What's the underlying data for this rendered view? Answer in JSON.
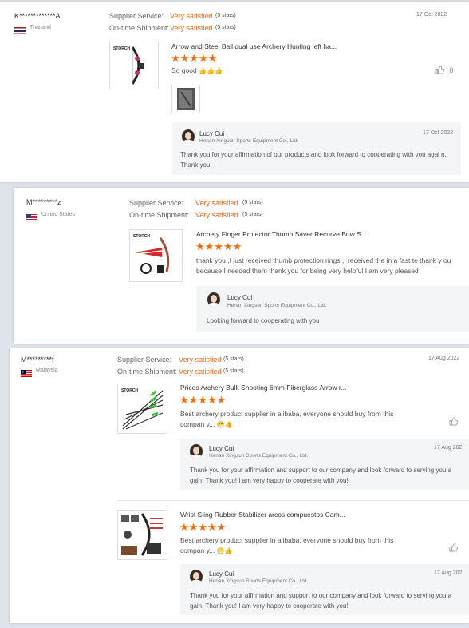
{
  "labels": {
    "supplier_service": "Supplier Service:",
    "ontime_shipment": "On-time Shipment:"
  },
  "reviews": [
    {
      "buyer": "K*************A",
      "country": "Thailand",
      "supplier_rating": "Very satisfied",
      "supplier_stars": "(5 stars)",
      "shipment_rating": "Very satisfied",
      "shipment_stars": "(5 stars)",
      "date": "17 Oct 2022",
      "products": [
        {
          "title": "Arrow and Steel Ball dual use Archery Hunting left ha...",
          "stars": "★★★★★",
          "comment": "So good",
          "emoji": "👍👍👍",
          "like_count": "0",
          "reply": {
            "name": "Lucy Cui",
            "company": "Henan Xingsun Sports Equipment Co., Ltd.",
            "date": "17 Oct 2022",
            "text": "Thank you for your affirmation of our products and look forward to cooperating with you agai n. Thank you!"
          }
        }
      ]
    },
    {
      "buyer": "M*********z",
      "country": "United States",
      "supplier_rating": "Very satisfied",
      "supplier_stars": "(5 stars)",
      "shipment_rating": "Very satisfied",
      "shipment_stars": "(5 stars)",
      "products": [
        {
          "title": "Archery Finger Protector Thumb Saver Recurve Bow S...",
          "stars": "★★★★★",
          "comment": "thank you ,I just received thumb protection rings ,I received the in a fast te thank y ou because I needed them thank you for being very helpful I am very pleased",
          "reply": {
            "name": "Lucy Cui",
            "company": "Henan Xingsun Sports Equipment Co., Ltd.",
            "text": "Looking forward to cooperating with you"
          }
        }
      ]
    },
    {
      "buyer": "M*********f",
      "country": "Malaysia",
      "supplier_rating": "Very satisfied",
      "supplier_stars": "(5 stars)",
      "shipment_rating": "Very satisfied",
      "shipment_stars": "(5 stars)",
      "date": "17 Aug 2022",
      "products": [
        {
          "title": "Prices Archery Bulk Shooting 6mm Fiberglass Arrow r...",
          "stars": "★★★★★",
          "comment": "Best archery product supplier in alibaba, everyone should buy from this compan y...",
          "emoji": "😁👍",
          "reply": {
            "name": "Lucy Cui",
            "company": "Henan Xingsun Sports Equipment Co., Ltd.",
            "date": "17 Aug 202",
            "text": "Thank you for your affirmation and support to our company and look forward to serving you a gain. Thank you! I am very happy to cooperate with you!"
          }
        },
        {
          "title": "Wrist Sling Rubber Stabilizer arcos compuestos Cam...",
          "stars": "★★★★★",
          "comment": "Best archery product supplier in alibaba, everyone should buy from this compan y...",
          "emoji": "😁👍",
          "reply": {
            "name": "Lucy Cui",
            "company": "Henan Xingsun Sports Equipment Co., Ltd.",
            "date": "17 Aug 202",
            "text": "Thank you for your affirmation and support to our company and look forward to serving you a gain. Thank you! I am very happy to cooperate with you!"
          }
        }
      ]
    }
  ],
  "colors": {
    "rating": "#f26c1a",
    "star": "#ff6a00",
    "reply_bg": "#f4f5f7"
  }
}
